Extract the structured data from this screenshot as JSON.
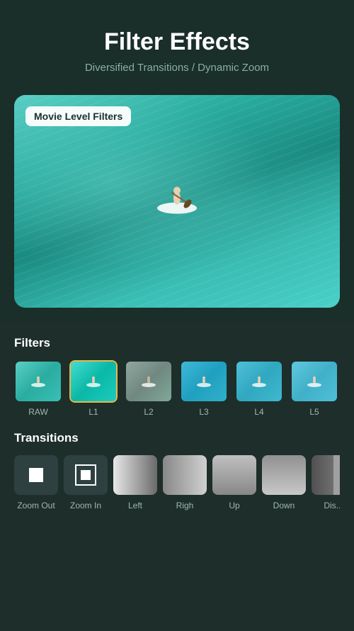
{
  "header": {
    "title": "Filter Effects",
    "subtitle": "Diversified Transitions / Dynamic Zoom"
  },
  "preview": {
    "badge": "Movie Level Filters"
  },
  "filters": {
    "section_title": "Filters",
    "items": [
      {
        "id": "raw",
        "label": "RAW",
        "active": false
      },
      {
        "id": "l1",
        "label": "L1",
        "active": true
      },
      {
        "id": "l2",
        "label": "L2",
        "active": false
      },
      {
        "id": "l3",
        "label": "L3",
        "active": false
      },
      {
        "id": "l4",
        "label": "L4",
        "active": false
      },
      {
        "id": "l5",
        "label": "L5",
        "active": false
      }
    ]
  },
  "transitions": {
    "section_title": "Transitions",
    "items": [
      {
        "id": "zoom-out",
        "label": "Zoom Out"
      },
      {
        "id": "zoom-in",
        "label": "Zoom In"
      },
      {
        "id": "left",
        "label": "Left"
      },
      {
        "id": "right",
        "label": "Righ"
      },
      {
        "id": "up",
        "label": "Up"
      },
      {
        "id": "down",
        "label": "Down"
      },
      {
        "id": "dissolve",
        "label": "Dis..."
      }
    ]
  },
  "colors": {
    "accent": "#e8b84b",
    "background": "#1a2e2a",
    "panel": "#1e2e2a",
    "text_muted": "#a0b8b0"
  }
}
